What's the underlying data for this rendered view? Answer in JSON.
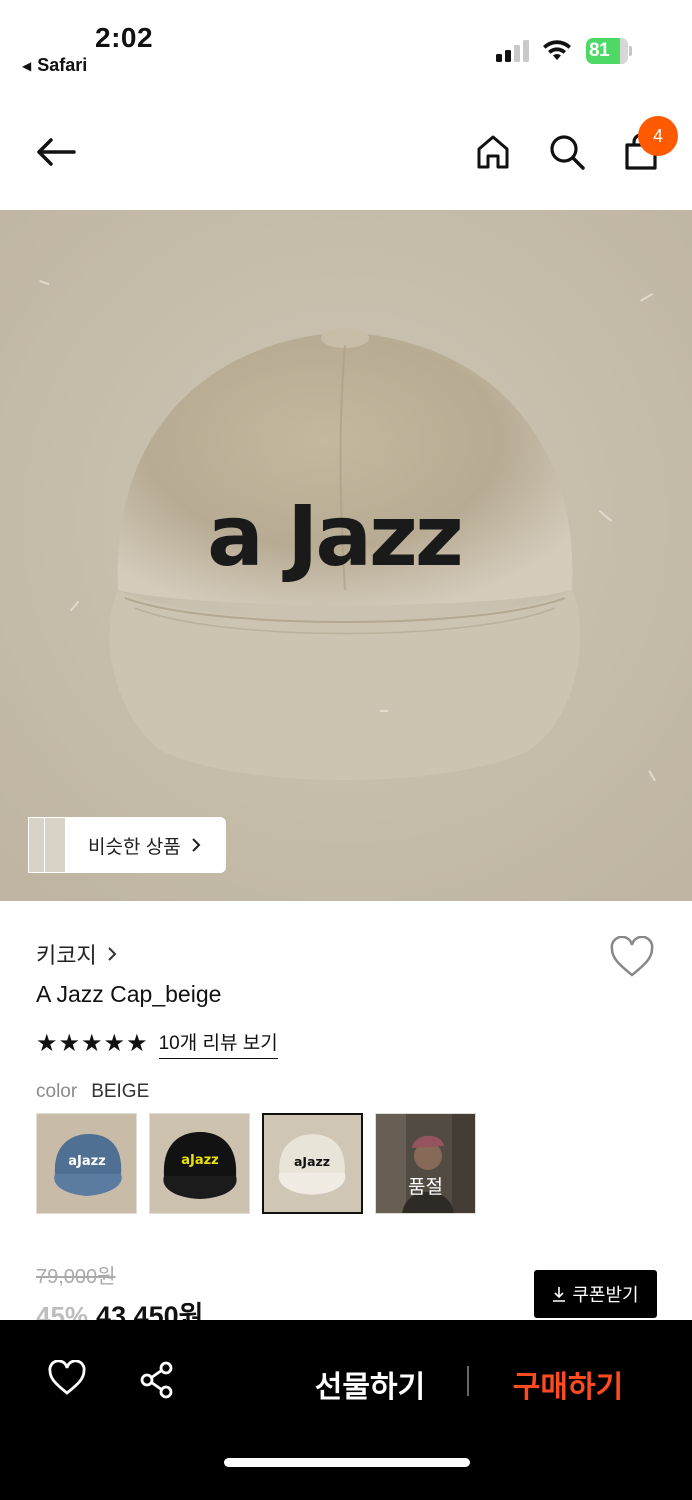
{
  "status_bar": {
    "time": "2:02",
    "back_app": "Safari",
    "battery": "81"
  },
  "header": {
    "cart_count": "4"
  },
  "hero": {
    "cap_text": "aJazz",
    "similar_label": "비슷한 상품"
  },
  "product": {
    "brand": "키코지",
    "title": "A Jazz Cap_beige",
    "stars": "★★★★★",
    "review_link": "10개 리뷰 보기",
    "color_key": "color",
    "color_value": "BEIGE",
    "swatches": [
      {
        "text": "aJazz",
        "bg": "#c8bca9",
        "cap": "#4f6f93",
        "logo": "#ffffff"
      },
      {
        "text": "aJazz",
        "bg": "#cdc2b0",
        "cap": "#121212",
        "logo": "#e8e200"
      },
      {
        "text": "aJazz",
        "bg": "#cfc6b6",
        "cap": "#e9e4d8",
        "logo": "#111111"
      },
      {
        "text": "품절",
        "bg": "#6e6458"
      }
    ],
    "original_price": "79,000원",
    "discount": "45%",
    "sale_price": "43,450원",
    "coupon_label": "쿠폰받기"
  },
  "bottom_bar": {
    "gift_label": "선물하기",
    "buy_label": "구매하기"
  },
  "colors": {
    "accent": "#ff5a00",
    "buy": "#ff4b1f",
    "hero_bg": "#c9bfad"
  }
}
